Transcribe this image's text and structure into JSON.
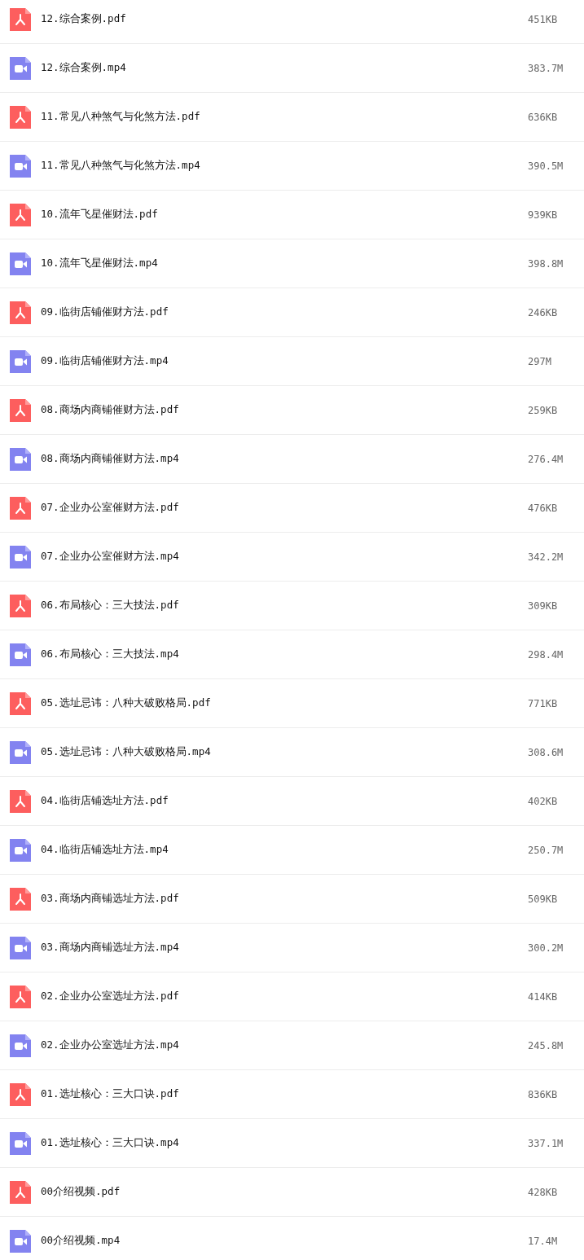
{
  "files": [
    {
      "kind": "pdf",
      "name": "12.综合案例.pdf",
      "size": "451KB"
    },
    {
      "kind": "video",
      "name": "12.综合案例.mp4",
      "size": "383.7M"
    },
    {
      "kind": "pdf",
      "name": "11.常见八种煞气与化煞方法.pdf",
      "size": "636KB"
    },
    {
      "kind": "video",
      "name": "11.常见八种煞气与化煞方法.mp4",
      "size": "390.5M"
    },
    {
      "kind": "pdf",
      "name": "10.流年飞星催财法.pdf",
      "size": "939KB"
    },
    {
      "kind": "video",
      "name": "10.流年飞星催财法.mp4",
      "size": "398.8M"
    },
    {
      "kind": "pdf",
      "name": "09.临街店铺催财方法.pdf",
      "size": "246KB"
    },
    {
      "kind": "video",
      "name": "09.临街店铺催财方法.mp4",
      "size": "297M"
    },
    {
      "kind": "pdf",
      "name": "08.商场内商铺催财方法.pdf",
      "size": "259KB"
    },
    {
      "kind": "video",
      "name": "08.商场内商铺催财方法.mp4",
      "size": "276.4M"
    },
    {
      "kind": "pdf",
      "name": "07.企业办公室催财方法.pdf",
      "size": "476KB"
    },
    {
      "kind": "video",
      "name": "07.企业办公室催财方法.mp4",
      "size": "342.2M"
    },
    {
      "kind": "pdf",
      "name": "06.布局核心：三大技法.pdf",
      "size": "309KB"
    },
    {
      "kind": "video",
      "name": "06.布局核心：三大技法.mp4",
      "size": "298.4M"
    },
    {
      "kind": "pdf",
      "name": "05.选址忌讳：八种大破败格局.pdf",
      "size": "771KB"
    },
    {
      "kind": "video",
      "name": "05.选址忌讳：八种大破败格局.mp4",
      "size": "308.6M"
    },
    {
      "kind": "pdf",
      "name": "04.临街店铺选址方法.pdf",
      "size": "402KB"
    },
    {
      "kind": "video",
      "name": "04.临街店铺选址方法.mp4",
      "size": "250.7M"
    },
    {
      "kind": "pdf",
      "name": "03.商场内商铺选址方法.pdf",
      "size": "509KB"
    },
    {
      "kind": "video",
      "name": "03.商场内商铺选址方法.mp4",
      "size": "300.2M"
    },
    {
      "kind": "pdf",
      "name": "02.企业办公室选址方法.pdf",
      "size": "414KB"
    },
    {
      "kind": "video",
      "name": "02.企业办公室选址方法.mp4",
      "size": "245.8M"
    },
    {
      "kind": "pdf",
      "name": "01.选址核心：三大口诀.pdf",
      "size": "836KB"
    },
    {
      "kind": "video",
      "name": "01.选址核心：三大口诀.mp4",
      "size": "337.1M"
    },
    {
      "kind": "pdf",
      "name": "00介绍视频.pdf",
      "size": "428KB"
    },
    {
      "kind": "video",
      "name": "00介绍视频.mp4",
      "size": "17.4M"
    }
  ]
}
